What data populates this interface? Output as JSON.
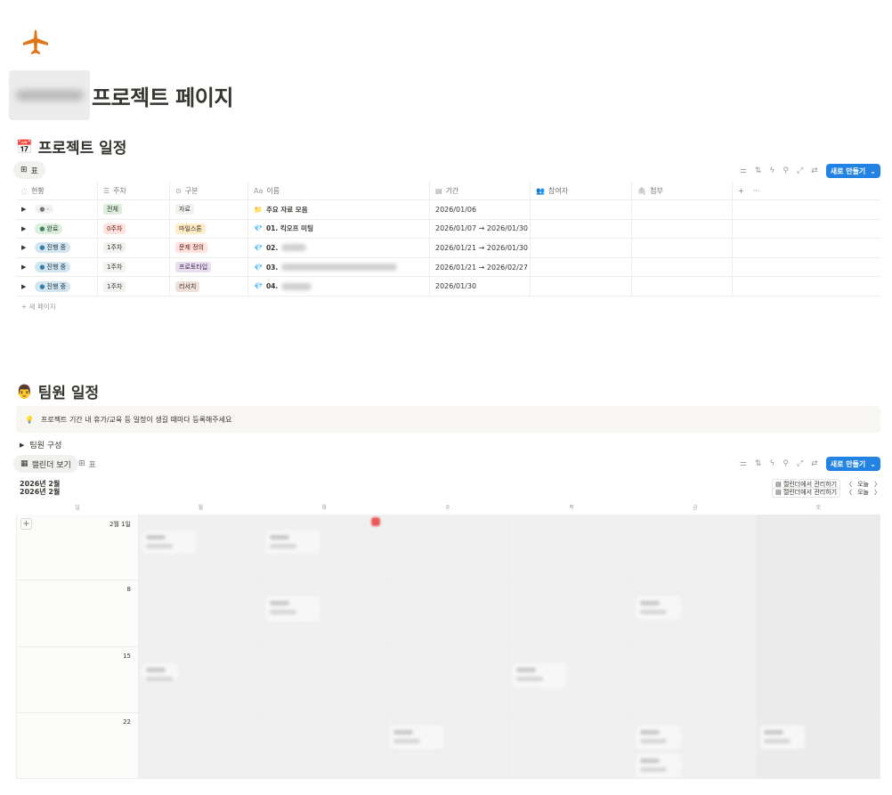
{
  "page": {
    "title": "프로젝트 페이지"
  },
  "schedule": {
    "heading_emoji": "📅",
    "heading": "프로젝트 일정",
    "view_tab": "표",
    "new_label": "새로 만들기",
    "columns": [
      "현황",
      "주차",
      "구분",
      "이름",
      "기간",
      "참여자",
      "첨부"
    ],
    "column_icons": [
      "status-icon",
      "list-icon",
      "select-icon",
      "text-icon",
      "calendar-icon",
      "people-icon",
      "paperclip-icon"
    ],
    "add_col": "+",
    "more_col": "···",
    "rows": [
      {
        "status": "-",
        "week": "전체",
        "category": "자료",
        "name_icon": "📁",
        "name": "주요 자료 모음",
        "period": "2026/01/06"
      },
      {
        "status": "완료",
        "week": "0주차",
        "category": "마일스톤",
        "name_icon": "💎",
        "name": "01. 킥오프 미팅",
        "period": "2026/01/07 → 2026/01/30"
      },
      {
        "status": "진행 중",
        "week": "1주차",
        "category": "문제 정의",
        "name_icon": "💎",
        "name": "02.",
        "period": "2026/01/21 → 2026/01/30"
      },
      {
        "status": "진행 중",
        "week": "1주차",
        "category": "프로토타입",
        "name_icon": "💎",
        "name": "03.",
        "period": "2026/01/21 → 2026/02/27"
      },
      {
        "status": "진행 중",
        "week": "1주차",
        "category": "리서치",
        "name_icon": "💎",
        "name": "04.",
        "period": "2026/01/30"
      }
    ],
    "new_page": "새 페이지"
  },
  "team": {
    "heading_emoji": "👨",
    "heading": "팀원 일정",
    "callout_icon": "💡",
    "callout": "프로젝트 기간 내 휴가/교육 등 일정이 생길 때마다 등록해주세요",
    "toggle": "팀원 구성",
    "tab_calendar": "캘린더 보기",
    "tab_table": "표",
    "new_label": "새로 만들기",
    "month_1": "2026년 2월",
    "month_2": "2026년 2월",
    "manage_1": "캘린더에서 관리하기",
    "manage_2": "캘린더에서 관리하기",
    "today_1": "오늘",
    "today_2": "오늘",
    "weekdays": [
      "일",
      "월",
      "화",
      "수",
      "목",
      "금",
      "토"
    ],
    "week_labels": [
      "2월 1일",
      "8",
      "15",
      "22"
    ]
  },
  "colors": {
    "accent": "#2383e2",
    "status_done_bg": "#dbeddb",
    "status_progress_bg": "#d3e5ef",
    "tag_all_bg": "#dbeddb",
    "tag_week0_bg": "#ffe2dd",
    "tag_milestone_bg": "#fdecc8",
    "tag_problem_bg": "#ffe2dd",
    "tag_proto_bg": "#e8deee",
    "tag_research_bg": "#eee0da"
  }
}
